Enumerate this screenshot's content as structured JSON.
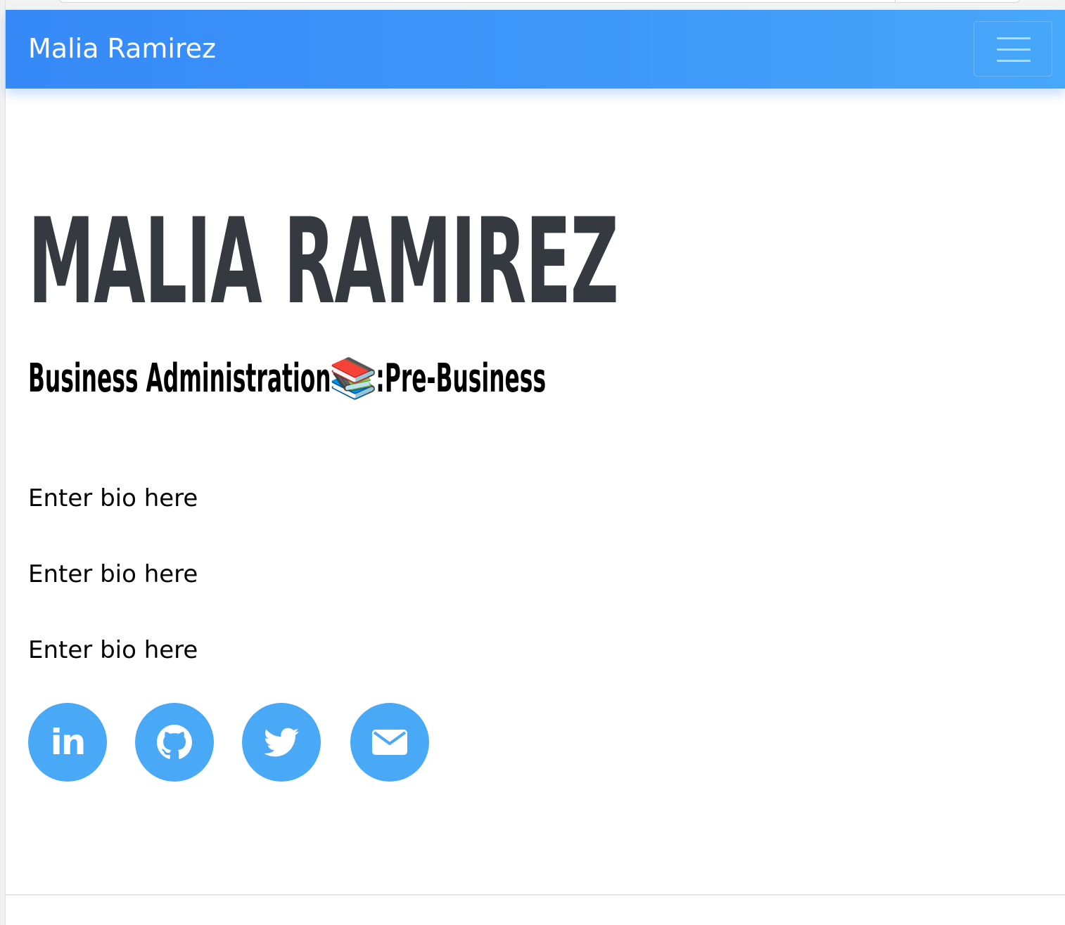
{
  "navbar": {
    "brand": "Malia Ramirez",
    "toggler_icon": "hamburger-menu-icon",
    "gradient_start": "#3689f7",
    "gradient_end": "#47a7f9"
  },
  "hero": {
    "name": "MALIA RAMIREZ",
    "subheading_before": "Business Administration",
    "subheading_emoji": "📚",
    "subheading_after": ":Pre-Business",
    "name_color": "#343a40"
  },
  "bio": [
    "Enter bio here",
    "Enter bio here",
    "Enter bio here"
  ],
  "social": {
    "color": "#49a9f7",
    "links": [
      {
        "icon": "linkedin-icon",
        "glyph": "in"
      },
      {
        "icon": "github-icon"
      },
      {
        "icon": "twitter-icon"
      },
      {
        "icon": "envelope-icon"
      }
    ]
  }
}
